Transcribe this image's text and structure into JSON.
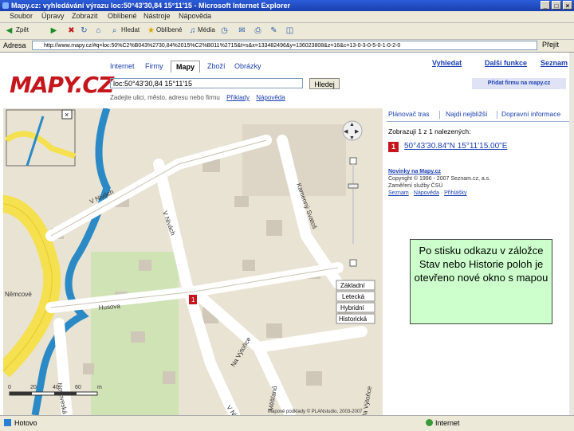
{
  "window": {
    "title": "Mapy.cz: vyhledávání výrazu loc:50°43'30,84 15°11'15 - Microsoft Internet Explorer",
    "buttons": [
      "_",
      "□",
      "×"
    ]
  },
  "menu": [
    "Soubor",
    "Úpravy",
    "Zobrazit",
    "Oblíbené",
    "Nástroje",
    "Nápověda"
  ],
  "toolbar": {
    "back": "Zpět",
    "search": "Hledat",
    "favorites": "Oblíbené",
    "media": "Média"
  },
  "address": {
    "label": "Adresa",
    "url": "http://www.mapy.cz/#q=loc:50%C2%B043%2730,84%2015%C2%B011%2715&t=s&x=133482496&y=136023808&z=16&c=13-0-3-0-5-0-1-0-2-0",
    "go": "Přejít"
  },
  "site": {
    "logo": "MAPY.CZ",
    "tabs": [
      "Internet",
      "Firmy",
      "Mapy",
      "Zboží",
      "Obrázky"
    ],
    "active_tab": "Mapy",
    "search_value": "loc:50°43'30,84 15°11'15",
    "search_button": "Hledej",
    "hint": "Zadejte ulici, město, adresu nebo firmu",
    "hint_links": [
      "Příklady",
      "Nápověda"
    ],
    "top_links": [
      "Vyhledat",
      "Další funkce",
      "Seznam"
    ],
    "add_firm": "Přidat firmu na mapy.cz"
  },
  "map": {
    "streets": [
      "V Nivách",
      "Husova",
      "V Nivách",
      "Na Výtoňce",
      "Na Výtoňce",
      "Kamenný Svatoš",
      "Novoveská",
      "V Nivách",
      "Měšťanů",
      "Na Výtoňce",
      "Němcové"
    ],
    "marker": "1",
    "layer_buttons": [
      "Základní",
      "Letecká",
      "Hybridní",
      "Historická"
    ],
    "scale": {
      "start": "0",
      "ticks": [
        "0",
        "20",
        "40",
        "60"
      ],
      "unit": "m"
    },
    "copyright": "Mapové podklady © PLANstudio, 2003-2007",
    "overview_label": "Němcové"
  },
  "panel": {
    "tabs": [
      "Plánovač tras",
      "Najdi nejbližší",
      "Dopravní informace"
    ],
    "found": "Zobrazuji 1 z 1 nalezených:",
    "result": {
      "num": "1",
      "coord": "50°43'30.84\"N 15°11'15.00\"E"
    },
    "news_title": "Novinky na Mapy.cz",
    "news_lines": [
      "Copyright © 1996 - 2007 Seznam.cz, a.s.",
      "Zaměření služby ČSÚ"
    ],
    "news_links": [
      "Seznam",
      "Nápověda",
      "Přihlášky"
    ]
  },
  "callout": "Po stisku odkazu v záložce Stav nebo Historie poloh je otevřeno nové okno s mapou",
  "status": {
    "left": "Hotovo",
    "zone": "Internet"
  }
}
